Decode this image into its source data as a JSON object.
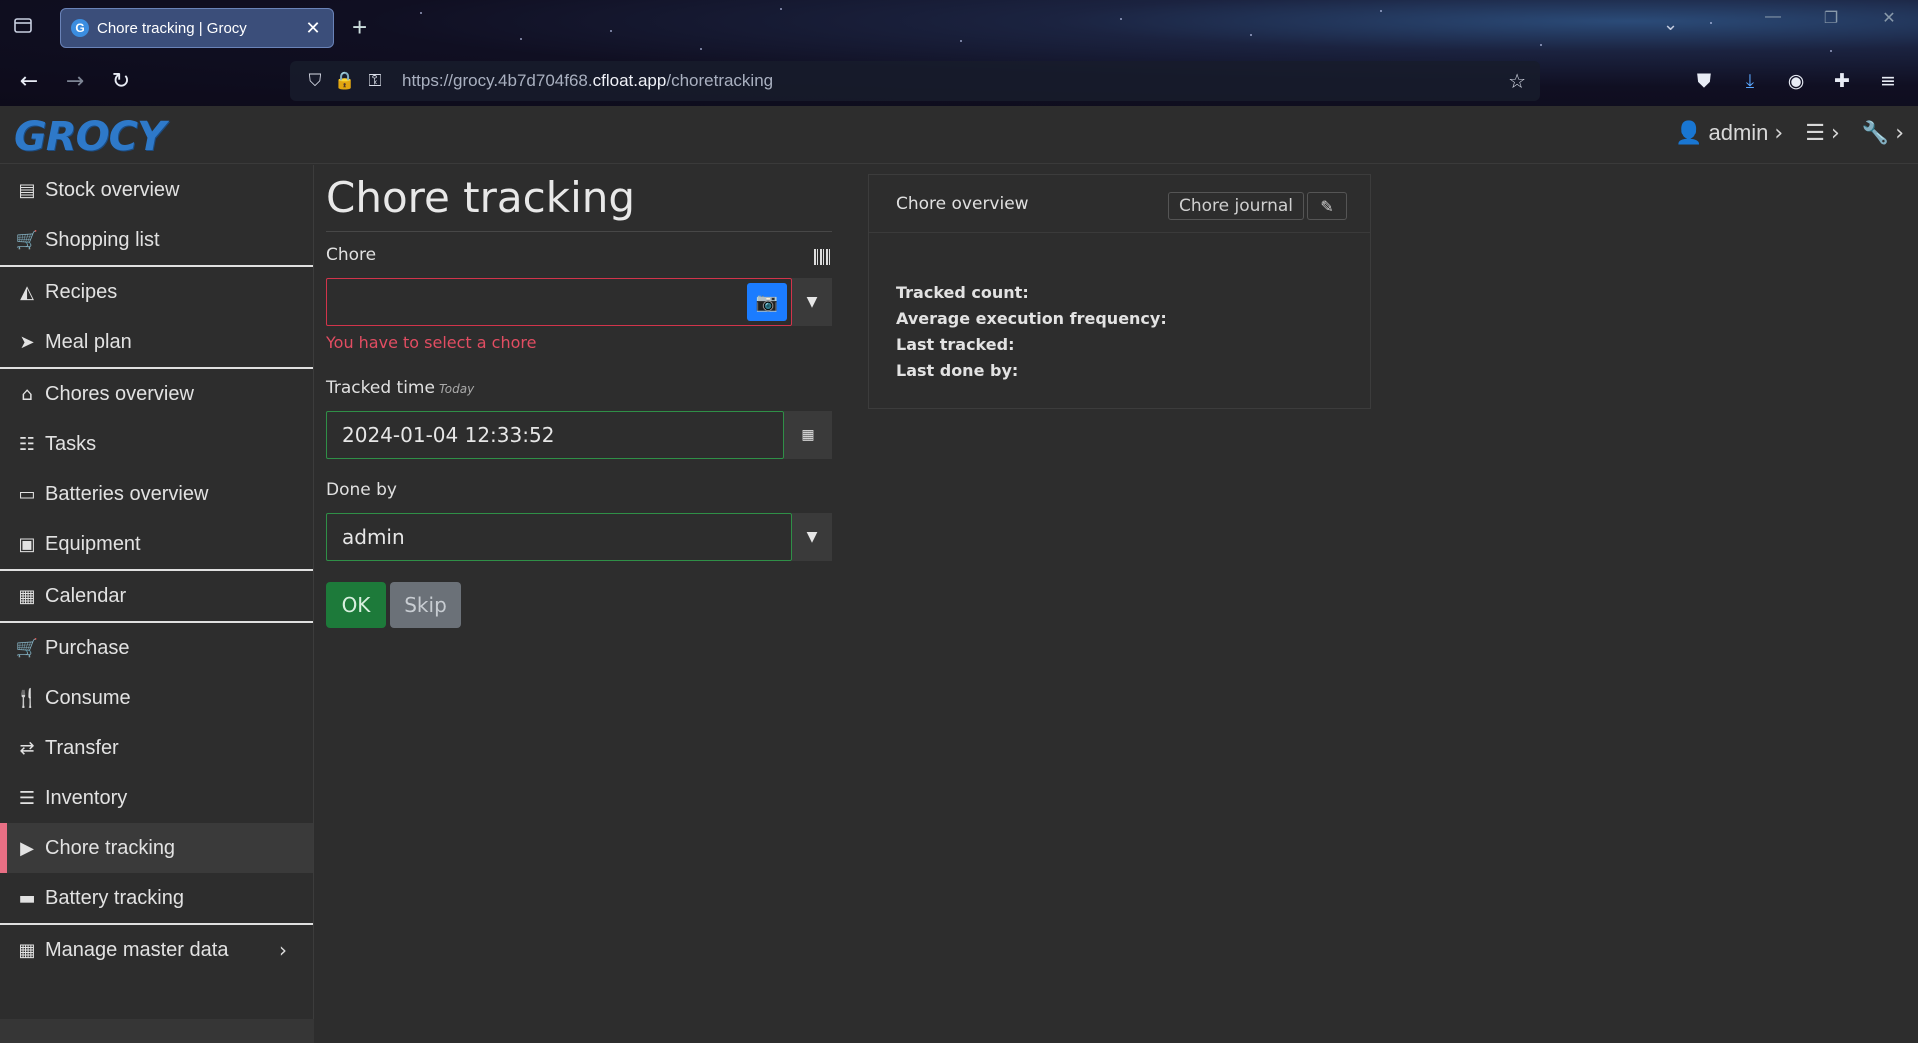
{
  "browser": {
    "tab_title": "Chore tracking | Grocy",
    "favicon_letter": "G",
    "url_prefix": "https://grocy.4b7d704f68.",
    "url_domain": "cfloat.app",
    "url_path": "/choretracking",
    "icons": {
      "tab_list": "tab-list-icon",
      "close": "close-icon",
      "new_tab": "plus-icon",
      "back": "arrow-left-icon",
      "forward": "arrow-right-icon",
      "reload": "reload-icon",
      "shield": "shield-icon",
      "lock": "lock-icon",
      "bookmark": "star-icon",
      "pocket": "pocket-icon",
      "download": "download-icon",
      "account": "account-icon",
      "extensions": "puzzle-icon",
      "menu": "hamburger-icon"
    }
  },
  "header": {
    "logo": "GROCY",
    "user": "admin"
  },
  "sidebar": {
    "items": [
      {
        "label": "Stock overview",
        "icon": "box-icon",
        "glyph": "▤"
      },
      {
        "label": "Shopping list",
        "icon": "cart-icon",
        "glyph": "🛒"
      },
      {
        "label": "Recipes",
        "icon": "pizza-icon",
        "glyph": "◭"
      },
      {
        "label": "Meal plan",
        "icon": "paper-plane-icon",
        "glyph": "➤"
      },
      {
        "label": "Chores overview",
        "icon": "home-icon",
        "glyph": "⌂"
      },
      {
        "label": "Tasks",
        "icon": "tasks-icon",
        "glyph": "☷"
      },
      {
        "label": "Batteries overview",
        "icon": "battery-icon",
        "glyph": "▭"
      },
      {
        "label": "Equipment",
        "icon": "toolbox-icon",
        "glyph": "▣"
      },
      {
        "label": "Calendar",
        "icon": "calendar-icon",
        "glyph": "▦"
      },
      {
        "label": "Purchase",
        "icon": "cart-plus-icon",
        "glyph": "🛒"
      },
      {
        "label": "Consume",
        "icon": "utensils-icon",
        "glyph": "🍴"
      },
      {
        "label": "Transfer",
        "icon": "exchange-icon",
        "glyph": "⇄"
      },
      {
        "label": "Inventory",
        "icon": "list-icon",
        "glyph": "☰"
      },
      {
        "label": "Chore tracking",
        "icon": "play-icon",
        "glyph": "▶"
      },
      {
        "label": "Battery tracking",
        "icon": "car-battery-icon",
        "glyph": "▬"
      },
      {
        "label": "Manage master data",
        "icon": "table-icon",
        "glyph": "▦"
      }
    ]
  },
  "main": {
    "title": "Chore tracking",
    "chore_label": "Chore",
    "chore_value": "",
    "chore_error": "You have to select a chore",
    "tracked_time_label": "Tracked time",
    "tracked_time_hint": "Today",
    "tracked_time_value": "2024-01-04 12:33:52",
    "done_by_label": "Done by",
    "done_by_value": "admin",
    "ok_label": "OK",
    "skip_label": "Skip"
  },
  "overview": {
    "title": "Chore overview",
    "journal_label": "Chore journal",
    "stats": [
      "Tracked count:",
      "Average execution frequency:",
      "Last tracked:",
      "Last done by:"
    ]
  },
  "colors": {
    "accent_active": "#e86f84",
    "camera_button": "#1b7cff",
    "ok_button": "#1d7a3a",
    "error": "#e24d62",
    "valid_border": "#2f8f47",
    "logo": "#2e79c9"
  }
}
